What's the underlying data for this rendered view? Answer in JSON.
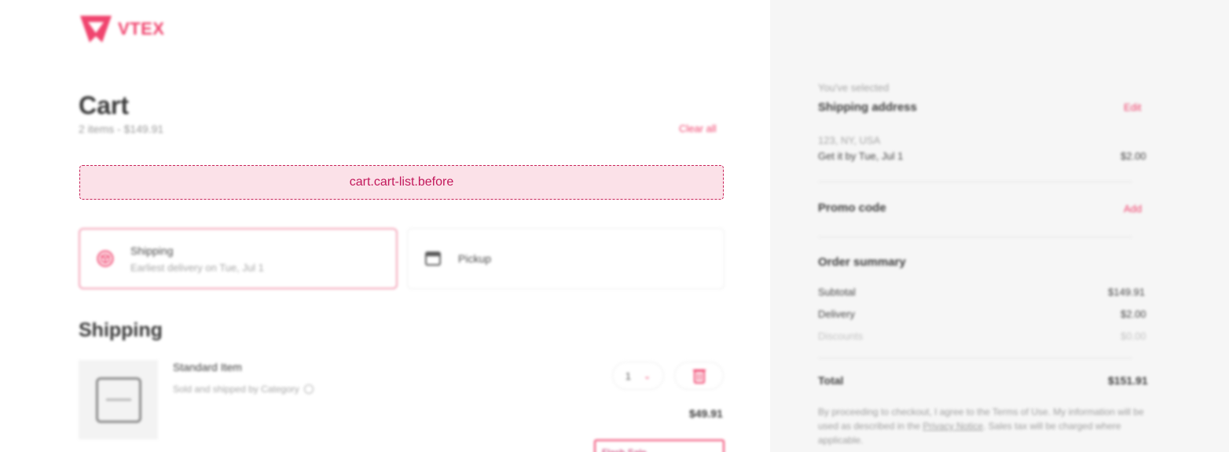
{
  "header": {
    "logo_text": "VTEX"
  },
  "cart": {
    "title": "Cart",
    "meta": "2 items - $149.91",
    "clear_all": "Clear all",
    "slot_label": "cart.cart-list.before",
    "delivery_options": [
      {
        "title": "Shipping",
        "subtitle": "Earliest delivery on Tue, Jul 1",
        "icon": "box-icon",
        "selected": true
      },
      {
        "title": "Pickup",
        "icon": "store-icon",
        "selected": false
      }
    ],
    "section_title": "Shipping",
    "item": {
      "name": "Standard Item",
      "seller": "Sold and shipped by Category",
      "quantity": "1",
      "price": "$49.91",
      "tag": "Flash Sale"
    }
  },
  "summary": {
    "selected_label": "You've selected",
    "shipping_address_title": "Shipping address",
    "edit_label": "Edit",
    "address": "123, NY, USA",
    "delivery_estimate": "Get it by Tue, Jul 1",
    "delivery_price": "$2.00",
    "promo_title": "Promo code",
    "promo_add": "Add",
    "order_summary_title": "Order summary",
    "rows": [
      {
        "label": "Subtotal",
        "value": "$149.91"
      },
      {
        "label": "Delivery",
        "value": "$2.00"
      },
      {
        "label": "Discounts",
        "value": "$0.00"
      }
    ],
    "total_label": "Total",
    "total_value": "$151.91",
    "disclaimer_before": "By proceeding to checkout, I agree to the Terms of Use. My information will be used as described in the ",
    "privacy_link": "Privacy Notice",
    "disclaimer_after": ". Sales tax will be charged where applicable."
  },
  "colors": {
    "accent": "#f0446e",
    "slot_border": "#c8255a",
    "slot_bg": "#fbe1e8",
    "sidebar_bg": "#f6f6f6"
  }
}
